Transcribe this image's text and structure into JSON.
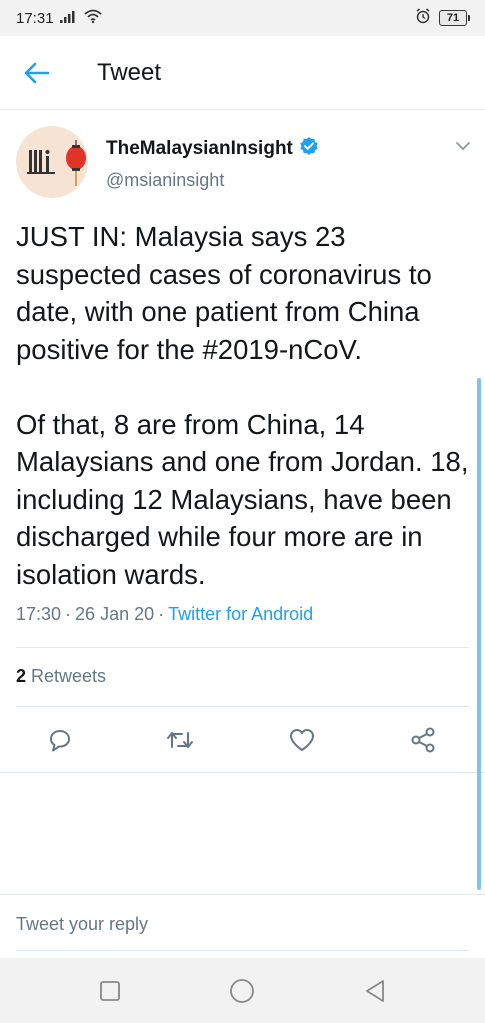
{
  "status_bar": {
    "time": "17:31",
    "battery": "71"
  },
  "app_bar": {
    "title": "Tweet"
  },
  "tweet": {
    "author": {
      "display_name": "TheMalaysianInsight",
      "handle": "@msianinsight",
      "verified": true
    },
    "paragraphs": [
      "JUST IN: Malaysia says 23 suspected cases of coronavirus to date, with one patient from China positive for the #2019-nCoV.",
      "Of that, 8 are from China, 14 Malaysians and one from Jordan. 18, including 12 Malaysians, have been discharged while four more are in isolation wards."
    ],
    "time": "17:30",
    "date": "26 Jan 20",
    "source": "Twitter for Android",
    "retweet_count": "2",
    "retweet_label": "Retweets"
  },
  "actions": [
    {
      "name": "reply-icon"
    },
    {
      "name": "retweet-icon"
    },
    {
      "name": "like-icon"
    },
    {
      "name": "share-icon"
    }
  ],
  "reply_bar": {
    "placeholder": "Tweet your reply"
  },
  "colors": {
    "accent": "#1da1f2",
    "secondary_text": "#657786",
    "primary_text": "#14171a",
    "verified_badge": "#1da1f2"
  }
}
